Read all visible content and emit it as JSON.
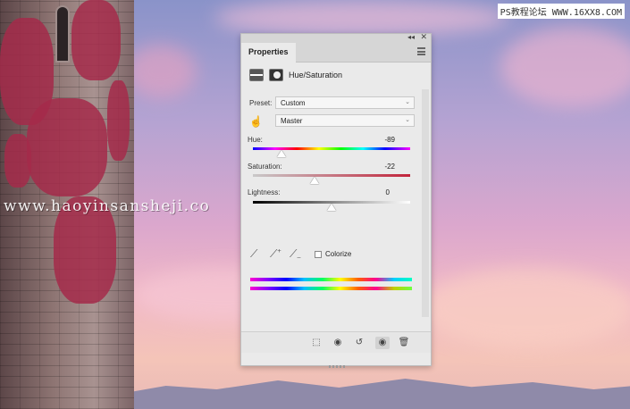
{
  "watermarks": {
    "top_right": "PS教程论坛 WWW.16XX8.COM",
    "middle": "www.haoyinsansheji.co"
  },
  "panel": {
    "tab_title": "Properties",
    "adjustment_title": "Hue/Saturation",
    "preset_label": "Preset:",
    "preset_value": "Custom",
    "channel_value": "Master",
    "hue": {
      "label": "Hue:",
      "value": "-89",
      "fraction": 0.18
    },
    "saturation": {
      "label": "Saturation:",
      "value": "-22",
      "fraction": 0.39
    },
    "lightness": {
      "label": "Lightness:",
      "value": "0",
      "fraction": 0.5
    },
    "colorize_label": "Colorize",
    "colorize_checked": false,
    "icons": [
      "hue-saturation-icon",
      "mask-icon",
      "hand-adjust-icon",
      "eyedropper-icon",
      "eyedropper-plus-icon",
      "eyedropper-minus-icon",
      "clip-to-layer-icon",
      "view-previous-icon",
      "reset-icon",
      "visibility-icon",
      "trash-icon"
    ]
  },
  "colors": {
    "panel_bg": "#eaeaea",
    "ivy": "#a52a4a",
    "saturation_track_end": "#c2243b"
  }
}
